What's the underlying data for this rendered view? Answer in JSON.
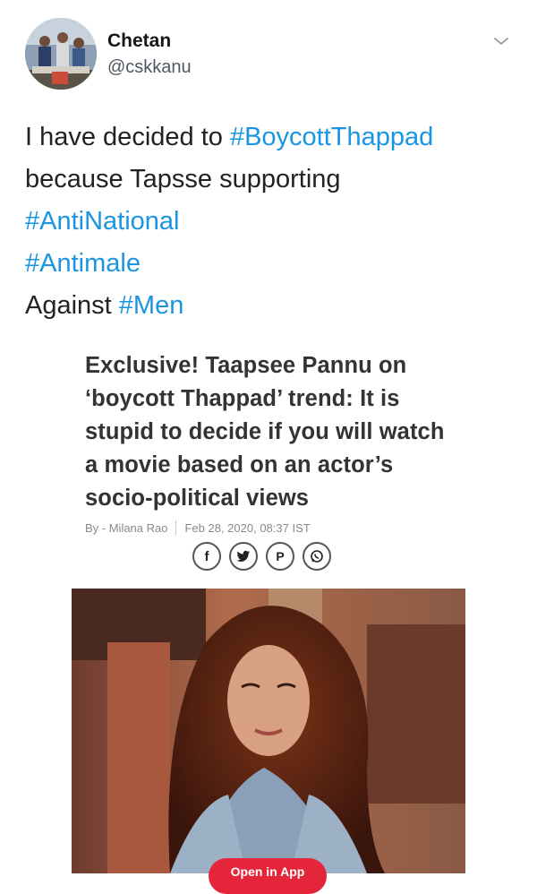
{
  "tweet": {
    "author": {
      "name": "Chetan",
      "handle": "@cskkanu"
    },
    "text_lines": [
      [
        {
          "text": "I have decided to "
        },
        {
          "text": "#BoycottThappad",
          "hashtag": true
        }
      ],
      [
        {
          "text": "because Tapsse supporting"
        }
      ],
      [
        {
          "text": "#AntiNational",
          "hashtag": true
        }
      ],
      [
        {
          "text": "#Antimale",
          "hashtag": true
        }
      ],
      [
        {
          "text": "Against "
        },
        {
          "text": "#Men",
          "hashtag": true
        }
      ]
    ]
  },
  "article": {
    "title": "Exclusive! Taapsee Pannu on ‘boycott Thappad’ trend: It is stupid to decide if you will watch a movie based on an actor’s socio-political views",
    "byline": "By - Milana Rao",
    "date": "Feb 28, 2020, 08:37 IST",
    "share_buttons": [
      {
        "name": "facebook",
        "glyph": "f"
      },
      {
        "name": "twitter",
        "glyph": "🐦"
      },
      {
        "name": "pinterest",
        "glyph": "P"
      },
      {
        "name": "whatsapp",
        "glyph": "✆"
      }
    ],
    "open_in_app": "Open in App"
  },
  "colors": {
    "hashtag": "#1b95e0",
    "open_in_app": "#e5253a"
  }
}
